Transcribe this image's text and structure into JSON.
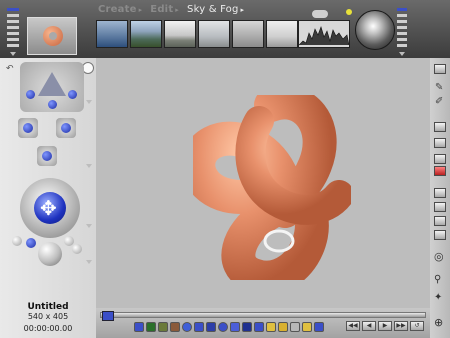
{
  "modes": [
    {
      "label": "Create",
      "active": false
    },
    {
      "label": "Edit",
      "active": false
    },
    {
      "label": "Sky & Fog",
      "active": true
    }
  ],
  "presets": [
    "sky-preset-1",
    "sky-preset-2",
    "sky-preset-3",
    "sky-preset-4",
    "sky-preset-5",
    "sky-preset-6",
    "histogram"
  ],
  "scene": {
    "title": "Untitled",
    "size": "540 x 405",
    "time": "00:00:00.00"
  },
  "colors": {
    "canvas": "#bdbdbd",
    "knot": "#e8916c",
    "accent": "#3b4fc8"
  },
  "icons": [
    "cloud-icon",
    "sun-icon",
    "sphere-preview",
    "camera-trackball-icon",
    "move-arrows-icon",
    "light-icon",
    "play-icon"
  ]
}
